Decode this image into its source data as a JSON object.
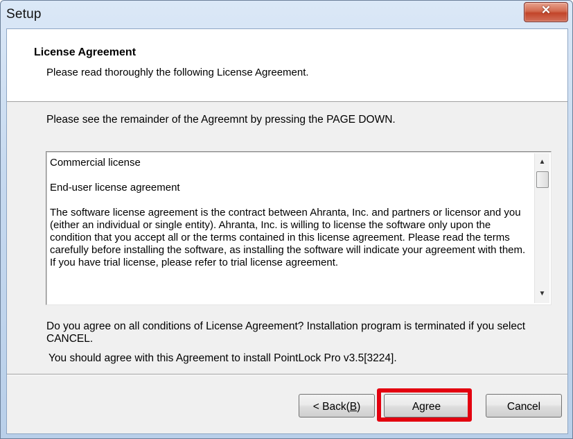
{
  "window": {
    "title": "Setup",
    "close_glyph": "✕"
  },
  "header": {
    "title": "License Agreement",
    "subtitle": "Please read thoroughly the following License Agreement."
  },
  "instruction": "Please see the remainder of the Agreemnt by pressing the PAGE DOWN.",
  "license": {
    "paragraphs": [
      "Commercial license",
      "End-user license agreement",
      "The software license agreement is the contract between Ahranta, Inc. and partners or licensor and you (either an individual or single entity). Ahranta, Inc. is willing to license the software only upon the condition that you accept all or the terms contained in this license agreement. Please read the terms carefully before installing the software, as installing the software will indicate your agreement with them. If you have trial license, please refer to trial license agreement."
    ],
    "scroll_up_glyph": "▲",
    "scroll_down_glyph": "▼"
  },
  "question": "Do you agree on all conditions of License Agreement? Installation program is terminated if you select CANCEL.",
  "note": "You should agree with this Agreement to install PointLock Pro v3.5[3224].",
  "buttons": {
    "back_prefix": "< Back(",
    "back_key": "B",
    "back_suffix": ")",
    "agree": "Agree",
    "cancel": "Cancel"
  },
  "colors": {
    "highlight": "#e3000f"
  }
}
